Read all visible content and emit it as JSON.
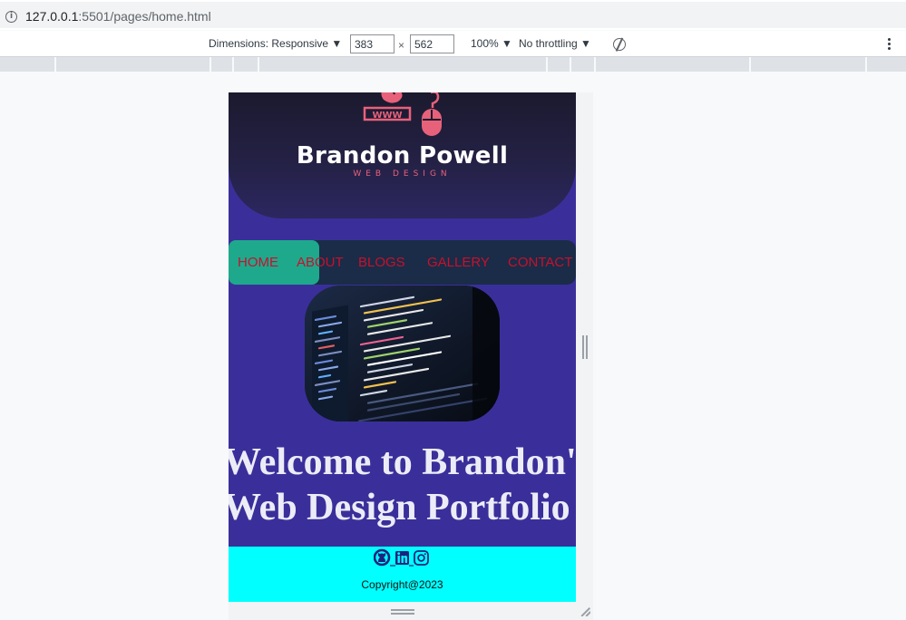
{
  "browser": {
    "url_host": "127.0.0.1",
    "url_rest": ":5501/pages/home.html"
  },
  "devtools": {
    "dimensions_label": "Dimensions: Responsive",
    "width_value": "383",
    "height_value": "562",
    "times": "×",
    "zoom": "100%",
    "throttling": "No throttling"
  },
  "site": {
    "brand_name": "Brandon Powell",
    "brand_sub": "WEB DESIGN",
    "logo_text": "WWW",
    "nav": [
      {
        "label": "HOME"
      },
      {
        "label": "ABOUT"
      },
      {
        "label": "BLOGS"
      },
      {
        "label": "GALLERY"
      },
      {
        "label": "CONTACT"
      }
    ],
    "welcome_line1": "Welcome to Brandon's",
    "welcome_line2": "Web Design Portfolio",
    "social_icons": [
      "github-icon",
      "linkedin-icon",
      "instagram-icon"
    ],
    "copyright": "Copyright@2023"
  },
  "colors": {
    "page_bg": "#3a2f9a",
    "nav_bg": "#1a2c47",
    "nav_active": "#1ea98c",
    "nav_text": "#c8102e",
    "footer_bg": "#00ffff",
    "accent_pink": "#e8617a"
  }
}
